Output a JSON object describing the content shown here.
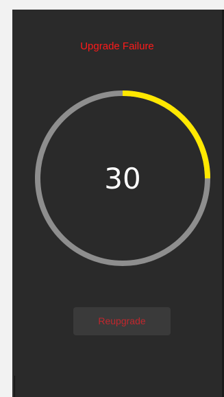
{
  "screen": {
    "title": "Upgrade Failure",
    "countdown": "30",
    "progress": 0.25,
    "progress_color": "#ffe800",
    "track_color": "#8e8e8e",
    "title_color": "#ff1a1a",
    "button_label": "Reupgrade",
    "button_text_color": "#c1272d"
  }
}
